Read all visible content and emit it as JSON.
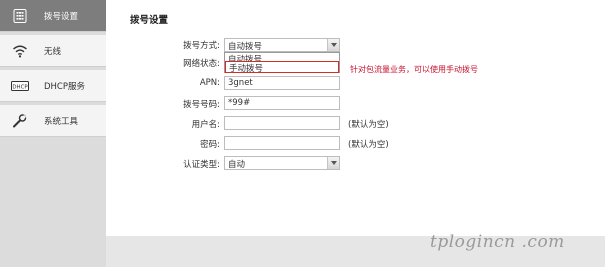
{
  "sidebar": {
    "items": [
      {
        "label": "拨号设置",
        "icon": "phone-keypad-icon",
        "active": true
      },
      {
        "label": "无线",
        "icon": "wifi-icon",
        "active": false
      },
      {
        "label": "DHCP服务",
        "icon": "dhcp-icon",
        "active": false
      },
      {
        "label": "系统工具",
        "icon": "wrench-icon",
        "active": false
      }
    ],
    "dhcp_icon_text": "DHCP"
  },
  "main": {
    "section_title": "拨号设置",
    "dial_mode": {
      "label": "拨号方式:",
      "value": "自动拨号"
    },
    "dropdown_options": [
      "自动拨号",
      "手动拨号"
    ],
    "network_status": {
      "label": "网络状态:"
    },
    "note": "针对包流量业务，可以使用手动拨号",
    "apn": {
      "label": "APN:",
      "value": "3gnet"
    },
    "dial_number": {
      "label": "拨号号码:",
      "value": "*99#"
    },
    "username": {
      "label": "用户名:",
      "value": "",
      "hint": "(默认为空)"
    },
    "password": {
      "label": "密码:",
      "value": "",
      "hint": "(默认为空)"
    },
    "auth_type": {
      "label": "认证类型:",
      "value": "自动"
    }
  },
  "watermark": "tplogincn .com",
  "colors": {
    "active_nav": "#7d7d7d",
    "note_red": "#c8102e",
    "highlight_border": "#d92a2a"
  }
}
